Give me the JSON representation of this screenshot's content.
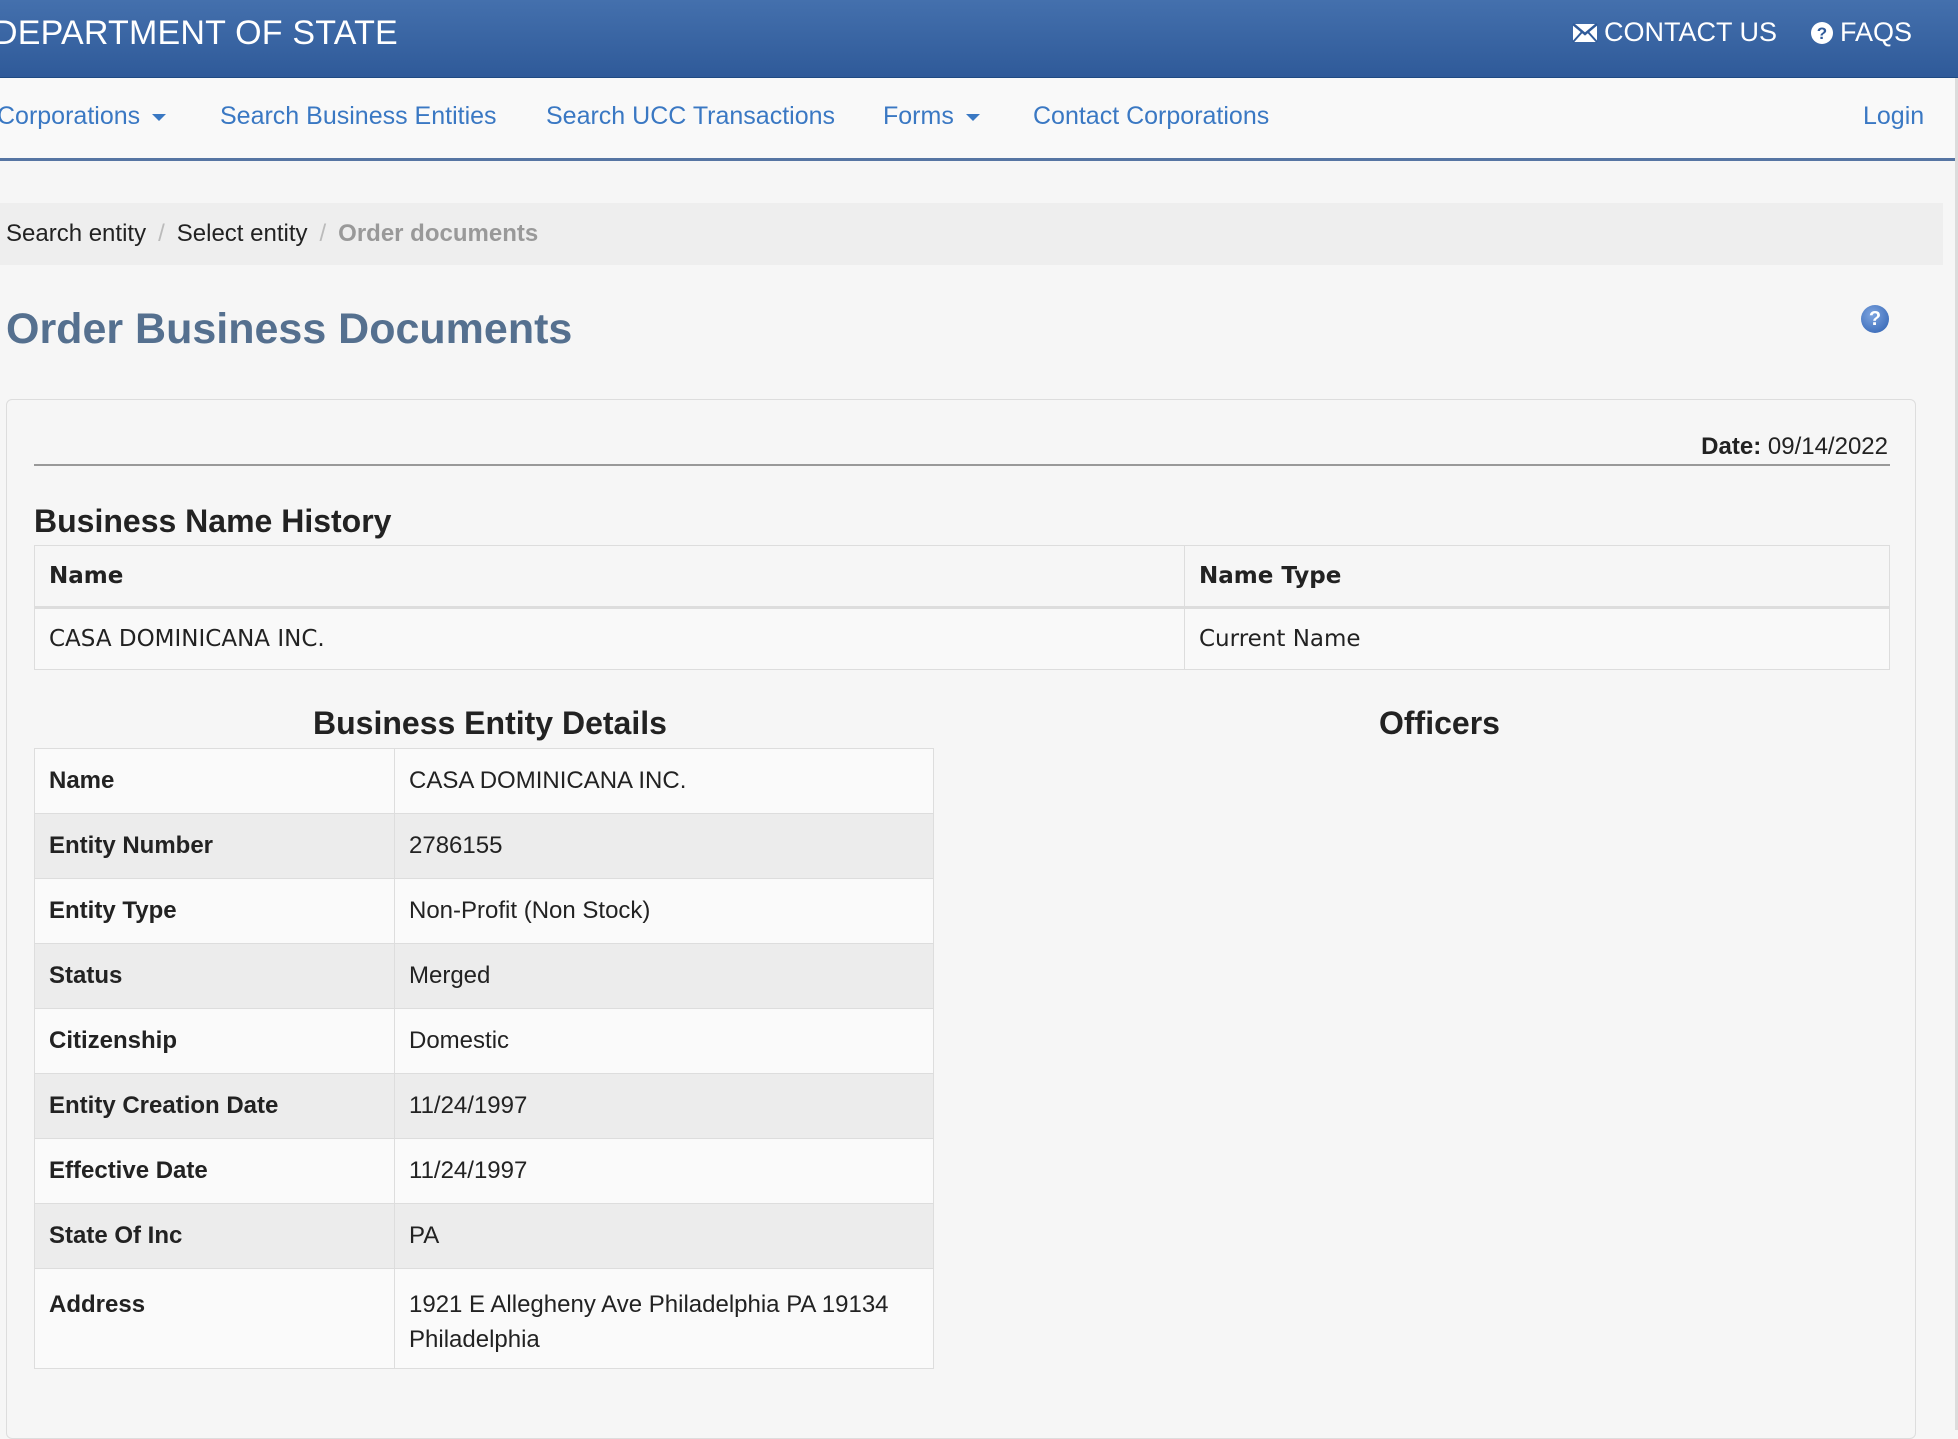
{
  "header": {
    "title": "DEPARTMENT OF STATE",
    "contact_label": "CONTACT US",
    "faqs_label": "FAQS"
  },
  "nav": {
    "items": [
      {
        "label": "Corporations",
        "dropdown": true
      },
      {
        "label": "Search Business Entities",
        "dropdown": false
      },
      {
        "label": "Search UCC Transactions",
        "dropdown": false
      },
      {
        "label": "Forms",
        "dropdown": true
      },
      {
        "label": "Contact Corporations",
        "dropdown": false
      }
    ],
    "login": "Login"
  },
  "breadcrumb": {
    "items": [
      "Search entity",
      "Select entity"
    ],
    "separator": "/",
    "active": "Order documents"
  },
  "page": {
    "title": "Order Business Documents",
    "help_icon": "question-circle-icon"
  },
  "panel": {
    "date_label": "Date",
    "date_value": "09/14/2022",
    "name_history": {
      "heading": "Business Name History",
      "columns": [
        "Name",
        "Name Type"
      ],
      "rows": [
        [
          "CASA DOMINICANA INC.",
          "Current Name"
        ]
      ]
    },
    "details": {
      "heading": "Business Entity Details",
      "rows": [
        {
          "label": "Name",
          "value": "CASA DOMINICANA INC."
        },
        {
          "label": "Entity Number",
          "value": "2786155"
        },
        {
          "label": "Entity Type",
          "value": "Non-Profit (Non Stock)"
        },
        {
          "label": "Status",
          "value": "Merged"
        },
        {
          "label": "Citizenship",
          "value": "Domestic"
        },
        {
          "label": "Entity Creation Date",
          "value": "11/24/1997"
        },
        {
          "label": "Effective Date",
          "value": "11/24/1997"
        },
        {
          "label": "State Of Inc",
          "value": "PA"
        },
        {
          "label": "Address",
          "value": "1921 E Allegheny Ave Philadelphia PA 19134",
          "value_line2": "Philadelphia"
        }
      ]
    },
    "officers": {
      "heading": "Officers"
    }
  },
  "colors": {
    "header_blue": "#3a65a4",
    "link_blue": "#3a78c3",
    "title_slate": "#55708f"
  }
}
